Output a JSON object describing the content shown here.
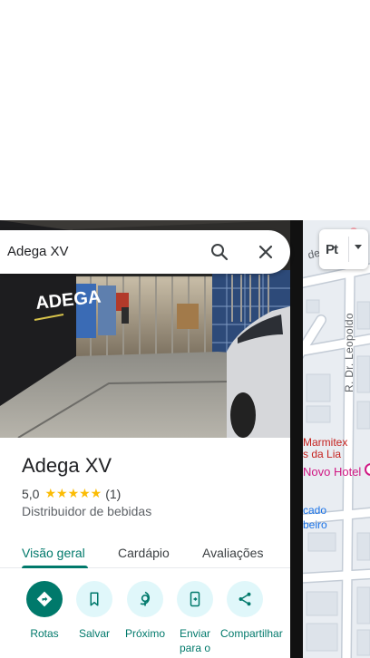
{
  "search": {
    "query": "Adega XV"
  },
  "place": {
    "name": "Adega XV",
    "rating": "5,0",
    "stars": "★★★★★",
    "review_count": "(1)",
    "category": "Distribuidor de bebidas"
  },
  "photo": {
    "sign_text": "ADEGA"
  },
  "tabs": [
    {
      "label": "Visão geral",
      "active": true
    },
    {
      "label": "Cardápio",
      "active": false
    },
    {
      "label": "Avaliações",
      "active": false
    }
  ],
  "actions": [
    {
      "label": "Rotas",
      "icon": "directions-icon"
    },
    {
      "label": "Salvar",
      "icon": "bookmark-icon"
    },
    {
      "label": "Próximo",
      "icon": "nearby-icon"
    },
    {
      "label": "Enviar para o",
      "icon": "send-to-phone-icon"
    },
    {
      "label": "Compartilhar",
      "icon": "share-icon"
    }
  ],
  "map": {
    "labels": {
      "souza": "de Souza",
      "leopoldo": "R. Dr. Leopoldo",
      "marmitex": "Marmitex",
      "lia": "s da Lia",
      "hotel": "Novo Hotel",
      "cado": "cado",
      "beiro": "beiro"
    },
    "layer_button": "Pt"
  },
  "colors": {
    "accent": "#00796b",
    "action_bg": "#e0f7fa",
    "star": "#fbbc04",
    "hotel": "#d01884",
    "food": "#c5221f",
    "transit": "#1a73e8"
  }
}
